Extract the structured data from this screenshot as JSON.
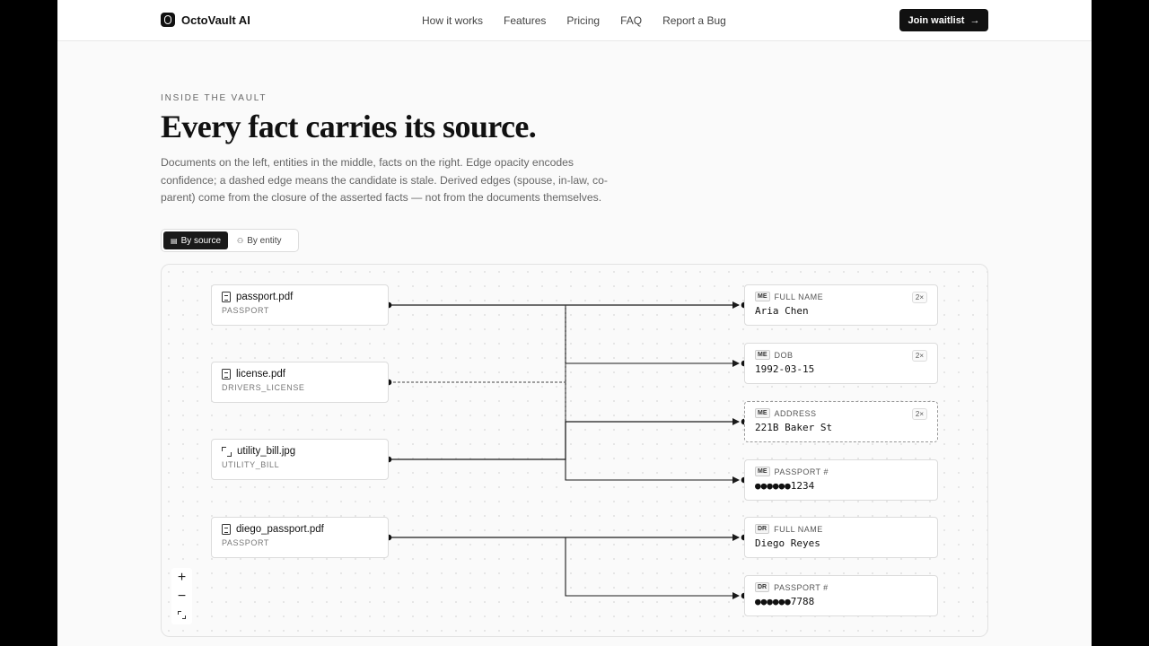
{
  "brand": {
    "name": "OctoVault AI"
  },
  "nav": {
    "links": [
      "How it works",
      "Features",
      "Pricing",
      "FAQ",
      "Report a Bug"
    ],
    "cta_label": "Join waitlist",
    "cta_icon": "→"
  },
  "hero": {
    "eyebrow": "INSIDE THE VAULT",
    "title": "Every fact carries its source.",
    "description": "Documents on the left, entities in the middle, facts on the right. Edge opacity encodes confidence; a dashed edge means the candidate is stale. Derived edges (spouse, in-law, co-parent) come from the closure of the asserted facts — not from the documents themselves."
  },
  "view_toggle": {
    "options": [
      {
        "label": "By source",
        "icon": "document-icon",
        "active": true
      },
      {
        "label": "By entity",
        "icon": "people-icon",
        "active": false
      }
    ]
  },
  "graph": {
    "documents": [
      {
        "name": "passport.pdf",
        "type": "PASSPORT",
        "icon": "document-icon"
      },
      {
        "name": "license.pdf",
        "type": "DRIVERS_LICENSE",
        "icon": "document-icon"
      },
      {
        "name": "utility_bill.jpg",
        "type": "UTILITY_BILL",
        "icon": "scan-icon"
      },
      {
        "name": "diego_passport.pdf",
        "type": "PASSPORT",
        "icon": "document-icon"
      }
    ],
    "facts": [
      {
        "owner": "ME",
        "label": "FULL NAME",
        "value": "Aria Chen",
        "badge": "2×",
        "stale": false
      },
      {
        "owner": "ME",
        "label": "DOB",
        "value": "1992-03-15",
        "badge": "2×",
        "stale": false
      },
      {
        "owner": "ME",
        "label": "ADDRESS",
        "value": "221B Baker St",
        "badge": "2×",
        "stale": true
      },
      {
        "owner": "ME",
        "label": "PASSPORT #",
        "value": "●●●●●●1234",
        "badge": "",
        "stale": false
      },
      {
        "owner": "DR",
        "label": "FULL NAME",
        "value": "Diego Reyes",
        "badge": "",
        "stale": false
      },
      {
        "owner": "DR",
        "label": "PASSPORT #",
        "value": "●●●●●●7788",
        "badge": "",
        "stale": false
      }
    ],
    "zoom_controls": [
      "+",
      "−"
    ]
  },
  "colors": {
    "primary": "#111111",
    "muted_text": "#666666",
    "edge": "#1a1a1a"
  }
}
